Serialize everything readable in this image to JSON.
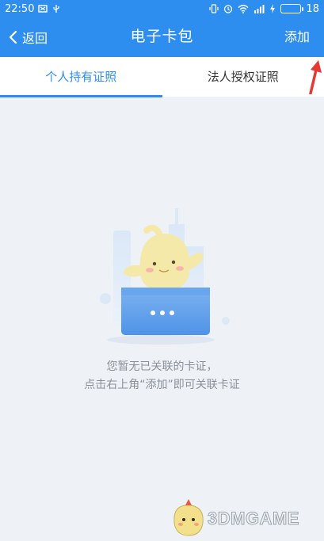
{
  "statusbar": {
    "time": "22:50",
    "battery": "18"
  },
  "navbar": {
    "back_label": "返回",
    "title": "电子卡包",
    "add_label": "添加"
  },
  "tabs": [
    {
      "label": "个人持有证照",
      "active": true
    },
    {
      "label": "法人授权证照",
      "active": false
    }
  ],
  "empty_state": {
    "line1": "您暂无已关联的卡证，",
    "line2": "点击右上角“添加”即可关联卡证"
  },
  "watermark": {
    "text": "3DMGAME"
  },
  "colors": {
    "primary": "#2e8ef0",
    "background": "#eef2f7",
    "annotation": "#e53935"
  },
  "icons": [
    "back-chevron-icon",
    "signal-icon",
    "wifi-icon",
    "battery-icon",
    "alarm-icon",
    "vibrate-icon"
  ]
}
